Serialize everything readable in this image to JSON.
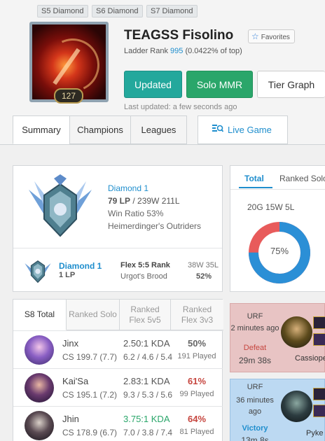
{
  "seasons": [
    "S5 Diamond",
    "S6 Diamond",
    "S7 Diamond"
  ],
  "profile": {
    "level": "127",
    "name": "TEAGSS Fisolino",
    "favorites_label": "Favorites",
    "ladder_prefix": "Ladder Rank ",
    "ladder_rank": "995",
    "ladder_suffix": " (0.0422% of top)",
    "last_updated": "Last updated: a few seconds ago"
  },
  "buttons": {
    "updated": "Updated",
    "solo_mmr": "Solo MMR",
    "tier_graph": "Tier Graph"
  },
  "tabs": [
    "Summary",
    "Champions",
    "Leagues"
  ],
  "live_game": "Live Game",
  "colors": {
    "teal": "#23a89c",
    "green": "#2aa66a",
    "blue": "#1f8ecd",
    "red": "#e05050"
  },
  "rank": {
    "tier": "Diamond 1",
    "lp_line": "79 LP / 239W 211L",
    "lp": "79 LP",
    "record": " / 239W 211L",
    "win_ratio": "Win Ratio 53%",
    "league_name": "Heimerdinger's Outriders"
  },
  "flex": {
    "tier": "Diamond 1",
    "lp": "1 LP",
    "queue": "Flex 5:5 Rank",
    "league": "Urgot's Brood",
    "record": "38W 35L",
    "ratio": "52%"
  },
  "winrate_panel": {
    "tabs": [
      "Total",
      "Ranked Solo"
    ],
    "summary": "20G 15W 5L",
    "percent_label": "75%",
    "win_fraction": 0.75
  },
  "champ_table": {
    "headers": [
      "S8 Total",
      "Ranked Solo",
      "Ranked Flex 5v5",
      "Ranked Flex 3v3"
    ],
    "rows": [
      {
        "name": "Jinx",
        "cs": "CS 199.7 (7.7)",
        "kda": "2.50:1 KDA",
        "kda_detail": "6.2 / 4.6 / 5.4",
        "winrate": "50%",
        "played": "191 Played"
      },
      {
        "name": "Kai'Sa",
        "cs": "CS 195.1 (7.2)",
        "kda": "2.83:1 KDA",
        "kda_detail": "9.3 / 5.3 / 5.6",
        "winrate": "61%",
        "played": "99 Played"
      },
      {
        "name": "Jhin",
        "cs": "CS 178.9 (6.7)",
        "kda": "3.75:1 KDA",
        "kda_detail": "7.0 / 3.8 / 7.4",
        "winrate": "64%",
        "played": "81 Played"
      }
    ]
  },
  "matches": [
    {
      "type": "URF",
      "time": "2 minutes ago",
      "result": "Defeat",
      "duration": "29m 38s",
      "champion": "Cassiope"
    },
    {
      "type": "URF",
      "time": "36 minutes ago",
      "result": "Victory",
      "duration": "13m 8s",
      "champion": "Pyke"
    }
  ]
}
